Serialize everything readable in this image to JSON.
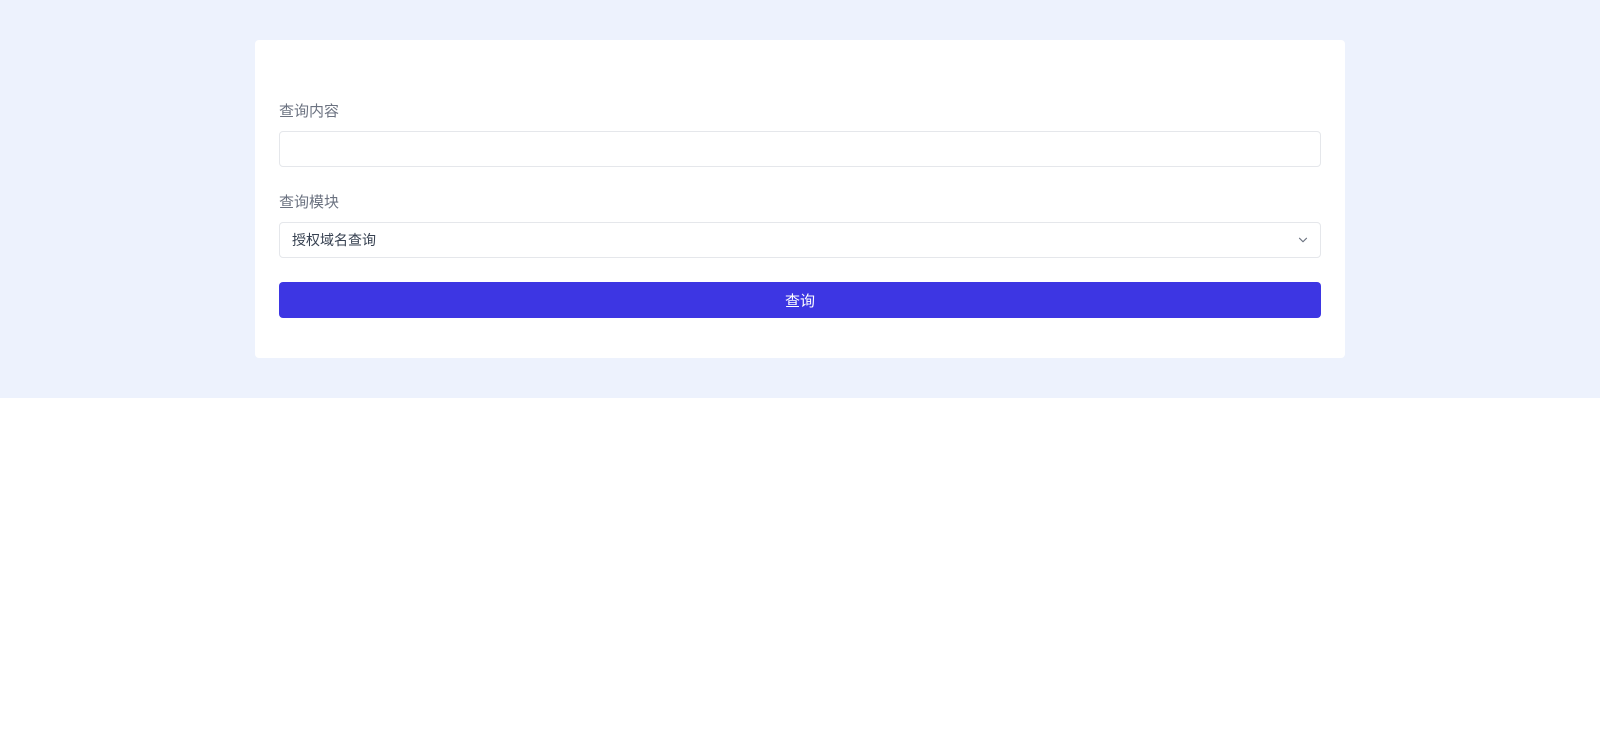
{
  "form": {
    "query_content": {
      "label": "查询内容",
      "value": ""
    },
    "query_module": {
      "label": "查询模块",
      "selected": "授权域名查询",
      "options": [
        "授权域名查询"
      ]
    },
    "submit_label": "查询"
  }
}
